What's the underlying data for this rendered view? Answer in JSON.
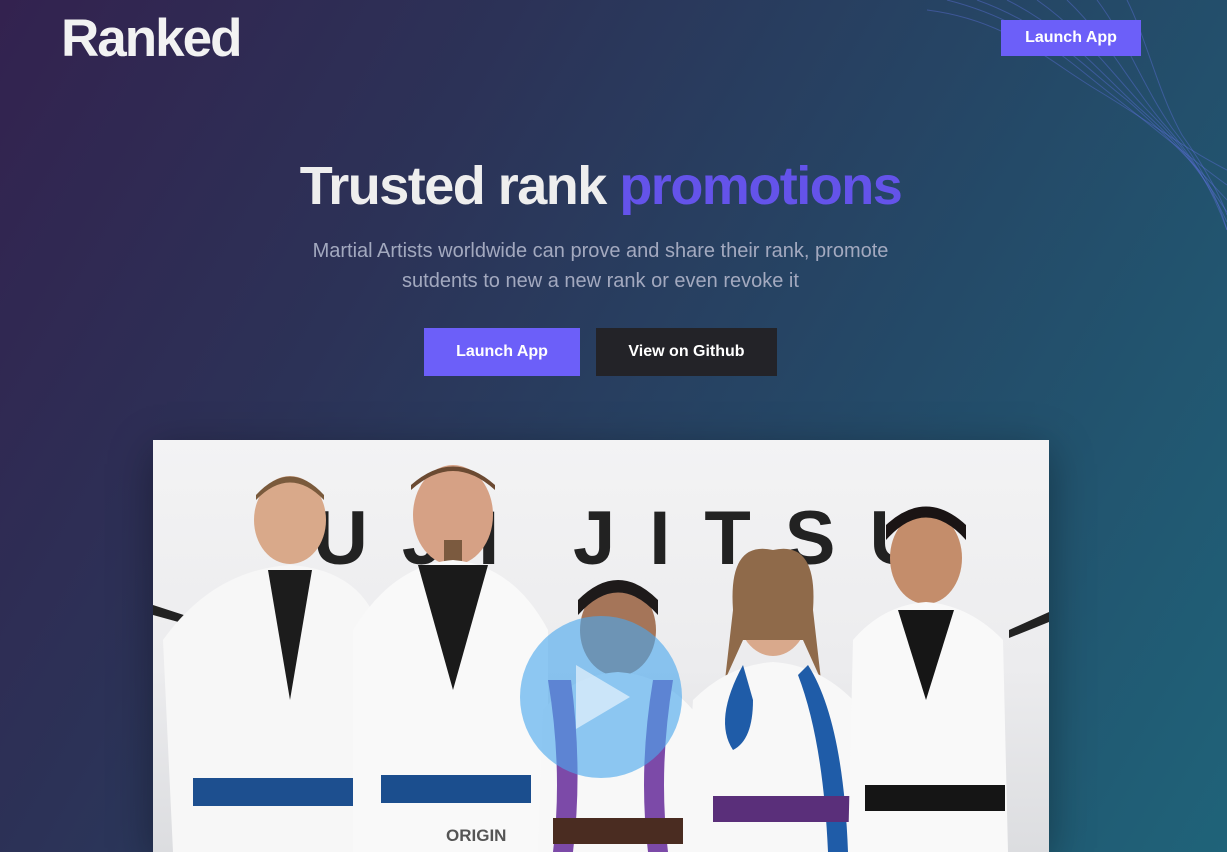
{
  "header": {
    "logo": "Ranked",
    "launch_label": "Launch App"
  },
  "hero": {
    "title_main": "Trusted rank ",
    "title_accent": "promotions",
    "subtitle_line1": "Martial Artists worldwide can prove and share their rank, promote",
    "subtitle_line2": "sutdents to new a new rank or even revoke it",
    "primary_label": "Launch App",
    "secondary_label": "View on Github"
  },
  "video": {
    "wall_left": "UJI",
    "wall_right": "JITSU",
    "brand": "ORIGIN",
    "play_icon": "play-icon"
  },
  "colors": {
    "accent": "#6c5ff9",
    "accent_text": "#6453ea",
    "dark_button": "#232328",
    "play_button": "#4aa8ed"
  }
}
